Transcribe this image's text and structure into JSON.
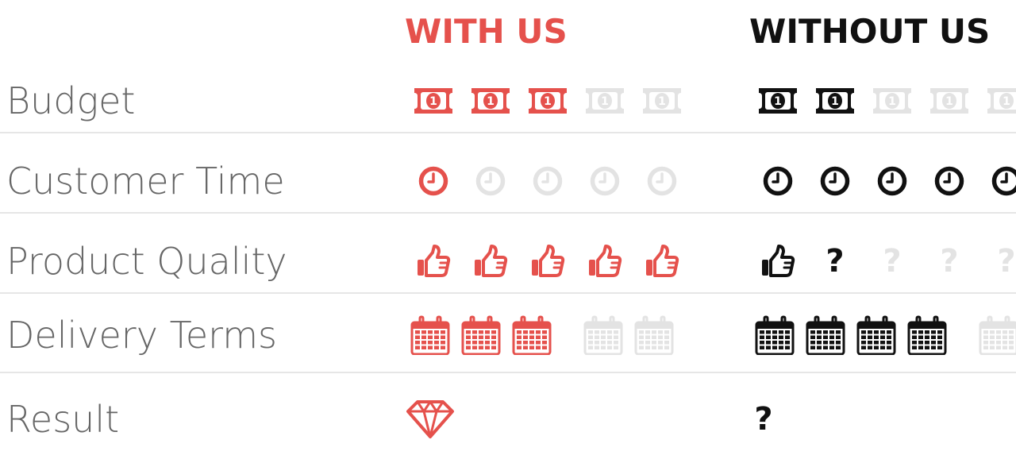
{
  "colors": {
    "accent": "#e5514c",
    "dark": "#111111",
    "inactive": "#e3e3e3",
    "label": "#666666",
    "divider": "#e6e6e6"
  },
  "columns": {
    "with": "WITH US",
    "without": "WITHOUT US"
  },
  "rows": [
    {
      "label": "Budget",
      "icon": "money-icon",
      "with_filled": 3,
      "with_total": 5,
      "without_filled": 2,
      "without_total": 5
    },
    {
      "label": "Customer Time",
      "icon": "clock-icon",
      "with_filled": 1,
      "with_total": 5,
      "without_filled": 5,
      "without_total": 5
    },
    {
      "label": "Product Quality",
      "icon": "thumbs-up-icon",
      "with_filled": 5,
      "with_total": 5,
      "without_filled": 1,
      "without_total": 1,
      "without_question_filled": 1,
      "without_question_total": 4,
      "question_mark": "?"
    },
    {
      "label": "Delivery Terms",
      "icon": "calendar-icon",
      "with_filled": 3,
      "with_total": 5,
      "without_filled": 4,
      "without_total": 5
    },
    {
      "label": "Result",
      "with_icon": "diamond-icon",
      "without_icon": "question-mark-icon",
      "question_mark": "?"
    }
  ]
}
